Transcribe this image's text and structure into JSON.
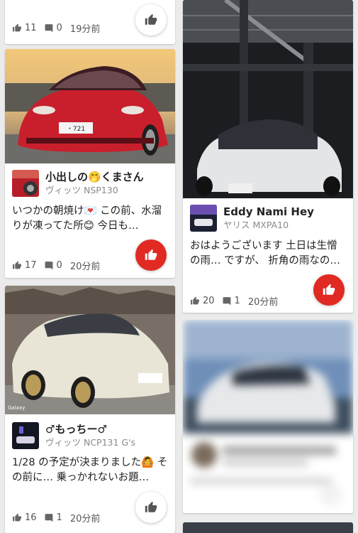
{
  "colors": {
    "accent": "#e02a22",
    "text": "#222222",
    "subtext": "#8a8a8a"
  },
  "cards": [
    {
      "likes": "11",
      "comments": "0",
      "time": "19分前",
      "liked": false
    },
    {
      "user": "小出しの🤭くまさん",
      "car": "ヴィッツ NSP130",
      "text": "いつかの朝焼け💌 この前、水溜りが凍ってた所😊 今日も…",
      "likes": "17",
      "comments": "0",
      "time": "20分前",
      "liked": true,
      "plate": "・721"
    },
    {
      "user": "♂もっちー♂",
      "car": "ヴィッツ NCP131 G's",
      "text": "1/28 の予定が決まりました🙆 その前に… 乗っかれないお題…",
      "likes": "16",
      "comments": "1",
      "time": "20分前",
      "liked": false,
      "photo_caption": "Galaxy"
    },
    {
      "user": "Eddy Nami Hey",
      "car": "ヤリス MXPA10",
      "text": "おはようございます 土日は生憎の雨… ですが、 折角の雨なの…",
      "likes": "20",
      "comments": "1",
      "time": "20分前",
      "liked": true
    }
  ]
}
